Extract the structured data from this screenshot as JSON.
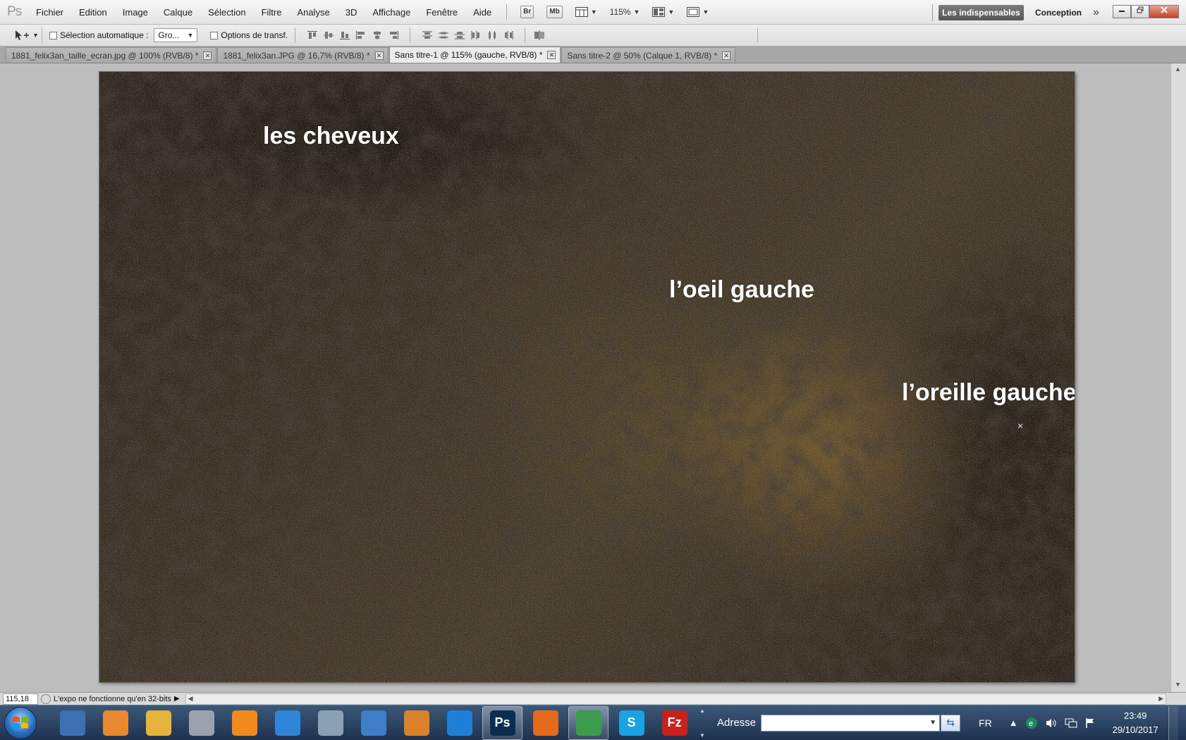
{
  "app": {
    "logo": "Ps",
    "menu": [
      "Fichier",
      "Edition",
      "Image",
      "Calque",
      "Sélection",
      "Filtre",
      "Analyse",
      "3D",
      "Affichage",
      "Fenêtre",
      "Aide"
    ],
    "bridge_label": "Br",
    "minibridge_label": "Mb",
    "zoom_value": "115%",
    "workspaces": {
      "active": "Les indispensables",
      "other": "Conception"
    }
  },
  "options_bar": {
    "auto_select_label": "Sélection automatique :",
    "auto_select_value": "Gro...",
    "transform_label": "Options de transf."
  },
  "tabs": [
    {
      "label": "1881_felix3an_taille_ecran.jpg @ 100% (RVB/8) *",
      "active": false
    },
    {
      "label": "1881_felix3an.JPG @ 16,7% (RVB/8) *",
      "active": false
    },
    {
      "label": "Sans titre-1 @ 115% (gauche, RVB/8) *",
      "active": true
    },
    {
      "label": "Sans titre-2 @ 50% (Calque 1, RVB/8) *",
      "active": false
    }
  ],
  "canvas": {
    "labels": [
      "les cheveux",
      "l’oeil gauche",
      "l’oreille gauche"
    ],
    "cursor": "×"
  },
  "status": {
    "zoom": "115,18 %",
    "message": "L'expo ne fonctionne qu'en 32-bits"
  },
  "taskbar": {
    "address_label": "Adresse",
    "language": "FR",
    "time": "23:49",
    "date": "29/10/2017",
    "apps": [
      {
        "name": "thunderbird",
        "color": "#3d6fb3"
      },
      {
        "name": "eye-app",
        "color": "#e8882f"
      },
      {
        "name": "file-explorer",
        "color": "#e6b43c"
      },
      {
        "name": "scanner",
        "color": "#9aa3ad"
      },
      {
        "name": "vlc",
        "color": "#f08a1c"
      },
      {
        "name": "bird-app",
        "color": "#2f86d6"
      },
      {
        "name": "calculator",
        "color": "#8ca0b5"
      },
      {
        "name": "wordpad",
        "color": "#3f7cc9"
      },
      {
        "name": "paint-app",
        "color": "#d9822b"
      },
      {
        "name": "internet-explorer",
        "color": "#1f7fd6"
      },
      {
        "name": "photoshop",
        "color": "#0b2d52",
        "label": "Ps",
        "active": true
      },
      {
        "name": "firefox",
        "color": "#e46a1e"
      },
      {
        "name": "chrome",
        "color": "#3b9c4d",
        "active": true
      },
      {
        "name": "skype",
        "color": "#1aa3e3",
        "label": "S"
      },
      {
        "name": "filezilla",
        "color": "#c7211c",
        "label": "Fz"
      }
    ]
  }
}
